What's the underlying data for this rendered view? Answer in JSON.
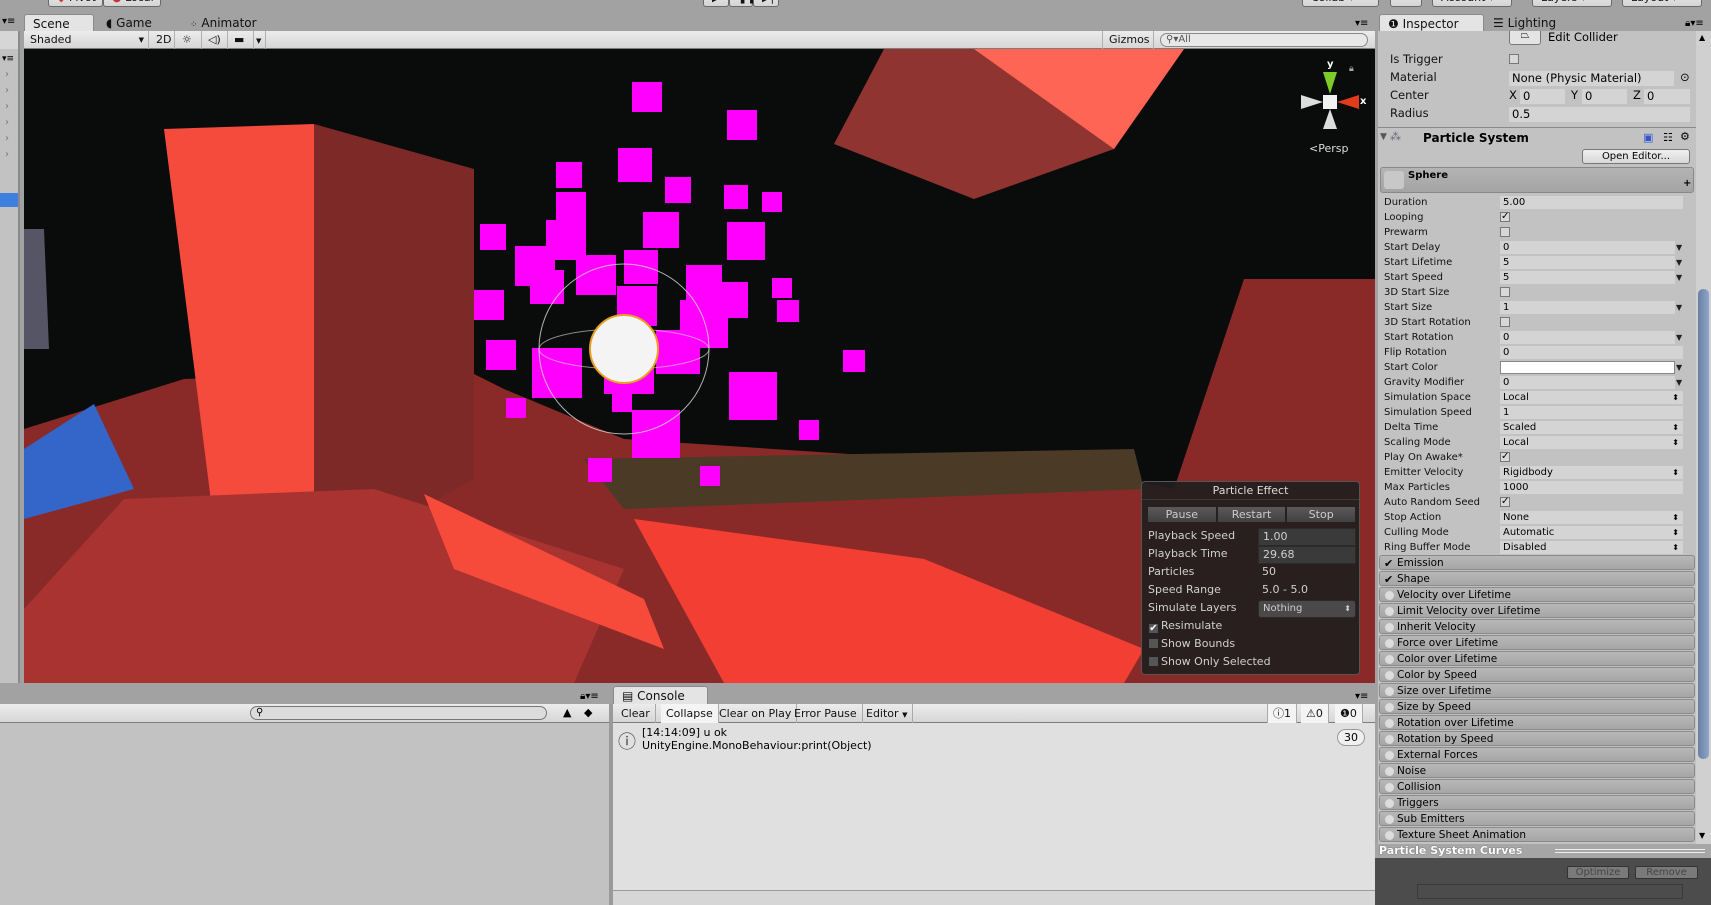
{
  "toolbar": {
    "pivot_label": "Pivot",
    "local_label": "Local",
    "collab_label": "Collab",
    "account_label": "Account",
    "layers_label": "Layers",
    "layout_label": "Layout"
  },
  "scene": {
    "tabs": [
      {
        "label": "Scene",
        "icon": "scene-icon",
        "active": true
      },
      {
        "label": "Game",
        "icon": "pacman-icon",
        "active": false
      },
      {
        "label": "Animator",
        "icon": "animator-icon",
        "active": false
      }
    ],
    "shading_mode": "Shaded",
    "mode_2d": "2D",
    "gizmos_label": "Gizmos",
    "search_placeholder": "All",
    "gizmo": {
      "x_label": "x",
      "y_label": "y",
      "projection": "Persp"
    },
    "colors": {
      "background": "#0a0b0b",
      "particles": "#ff00ff",
      "geometry": "#e8453a"
    }
  },
  "particle_effect": {
    "title": "Particle Effect",
    "buttons": [
      "Pause",
      "Restart",
      "Stop"
    ],
    "rows": [
      {
        "label": "Playback Speed",
        "value": "1.00",
        "field": true
      },
      {
        "label": "Playback Time",
        "value": "29.68",
        "field": true
      },
      {
        "label": "Particles",
        "value": "50",
        "field": false
      },
      {
        "label": "Speed Range",
        "value": "5.0 - 5.0",
        "field": false
      },
      {
        "label": "Simulate Layers",
        "value": "Nothing",
        "field": true
      }
    ],
    "checkboxes": [
      {
        "label": "Resimulate",
        "checked": true
      },
      {
        "label": "Show Bounds",
        "checked": false
      },
      {
        "label": "Show Only Selected",
        "checked": false
      }
    ]
  },
  "console": {
    "tab_label": "Console",
    "buttons": [
      "Clear",
      "Collapse",
      "Clear on Play",
      "Error Pause",
      "Editor"
    ],
    "counts": {
      "info": "1",
      "warning": "0",
      "error": "0"
    },
    "entries": [
      {
        "time_msg": "[14:14:09] u ok",
        "detail": "UnityEngine.MonoBehaviour:print(Object)",
        "count": "30"
      }
    ]
  },
  "inspector": {
    "tabs": [
      {
        "label": "Inspector",
        "active": true
      },
      {
        "label": "Lighting",
        "active": false
      }
    ],
    "collider": {
      "edit_collider_label": "Edit Collider",
      "is_trigger_label": "Is Trigger",
      "is_trigger": false,
      "material_label": "Material",
      "material_value": "None (Physic Material)",
      "center_label": "Center",
      "center": {
        "x": "0",
        "y": "0",
        "z": "0"
      },
      "radius_label": "Radius",
      "radius_value": "0.5"
    },
    "particle_system": {
      "title": "Particle System",
      "open_editor_label": "Open Editor...",
      "object_name": "Sphere",
      "properties": [
        {
          "label": "Duration",
          "type": "field",
          "value": "5.00"
        },
        {
          "label": "Looping",
          "type": "check",
          "value": true
        },
        {
          "label": "Prewarm",
          "type": "check",
          "value": false
        },
        {
          "label": "Start Delay",
          "type": "curve",
          "value": "0"
        },
        {
          "label": "Start Lifetime",
          "type": "curve",
          "value": "5"
        },
        {
          "label": "Start Speed",
          "type": "curve",
          "value": "5"
        },
        {
          "label": "3D Start Size",
          "type": "check",
          "value": false
        },
        {
          "label": "Start Size",
          "type": "curve",
          "value": "1"
        },
        {
          "label": "3D Start Rotation",
          "type": "check",
          "value": false
        },
        {
          "label": "Start Rotation",
          "type": "curve",
          "value": "0"
        },
        {
          "label": "Flip Rotation",
          "type": "field",
          "value": "0"
        },
        {
          "label": "Start Color",
          "type": "color",
          "value": "#ffffff"
        },
        {
          "label": "Gravity Modifier",
          "type": "curve",
          "value": "0"
        },
        {
          "label": "Simulation Space",
          "type": "select",
          "value": "Local"
        },
        {
          "label": "Simulation Speed",
          "type": "field",
          "value": "1"
        },
        {
          "label": "Delta Time",
          "type": "select",
          "value": "Scaled"
        },
        {
          "label": "Scaling Mode",
          "type": "select",
          "value": "Local"
        },
        {
          "label": "Play On Awake*",
          "type": "check",
          "value": true
        },
        {
          "label": "Emitter Velocity",
          "type": "select",
          "value": "Rigidbody"
        },
        {
          "label": "Max Particles",
          "type": "field",
          "value": "1000"
        },
        {
          "label": "Auto Random Seed",
          "type": "check",
          "value": true
        },
        {
          "label": "Stop Action",
          "type": "select",
          "value": "None"
        },
        {
          "label": "Culling Mode",
          "type": "select",
          "value": "Automatic"
        },
        {
          "label": "Ring Buffer Mode",
          "type": "select",
          "value": "Disabled"
        }
      ],
      "modules": [
        {
          "label": "Emission",
          "enabled": true
        },
        {
          "label": "Shape",
          "enabled": true
        },
        {
          "label": "Velocity over Lifetime",
          "enabled": false
        },
        {
          "label": "Limit Velocity over Lifetime",
          "enabled": false
        },
        {
          "label": "Inherit Velocity",
          "enabled": false
        },
        {
          "label": "Force over Lifetime",
          "enabled": false
        },
        {
          "label": "Color over Lifetime",
          "enabled": false
        },
        {
          "label": "Color by Speed",
          "enabled": false
        },
        {
          "label": "Size over Lifetime",
          "enabled": false
        },
        {
          "label": "Size by Speed",
          "enabled": false
        },
        {
          "label": "Rotation over Lifetime",
          "enabled": false
        },
        {
          "label": "Rotation by Speed",
          "enabled": false
        },
        {
          "label": "External Forces",
          "enabled": false
        },
        {
          "label": "Noise",
          "enabled": false
        },
        {
          "label": "Collision",
          "enabled": false
        },
        {
          "label": "Triggers",
          "enabled": false
        },
        {
          "label": "Sub Emitters",
          "enabled": false
        },
        {
          "label": "Texture Sheet Animation",
          "enabled": false
        }
      ]
    },
    "curves": {
      "title": "Particle System Curves",
      "optimize_label": "Optimize",
      "remove_label": "Remove"
    }
  }
}
